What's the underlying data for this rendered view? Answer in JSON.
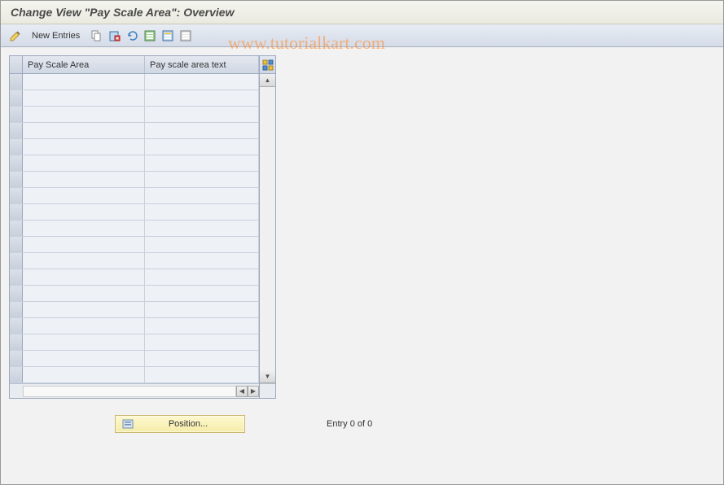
{
  "title": "Change View \"Pay Scale Area\": Overview",
  "toolbar": {
    "new_entries_label": "New Entries"
  },
  "table": {
    "columns": [
      "Pay Scale Area",
      "Pay scale area text"
    ],
    "row_count": 19
  },
  "position_button": {
    "label": "Position..."
  },
  "status": {
    "entry_text": "Entry 0 of 0"
  },
  "watermark": "www.tutorialkart.com"
}
